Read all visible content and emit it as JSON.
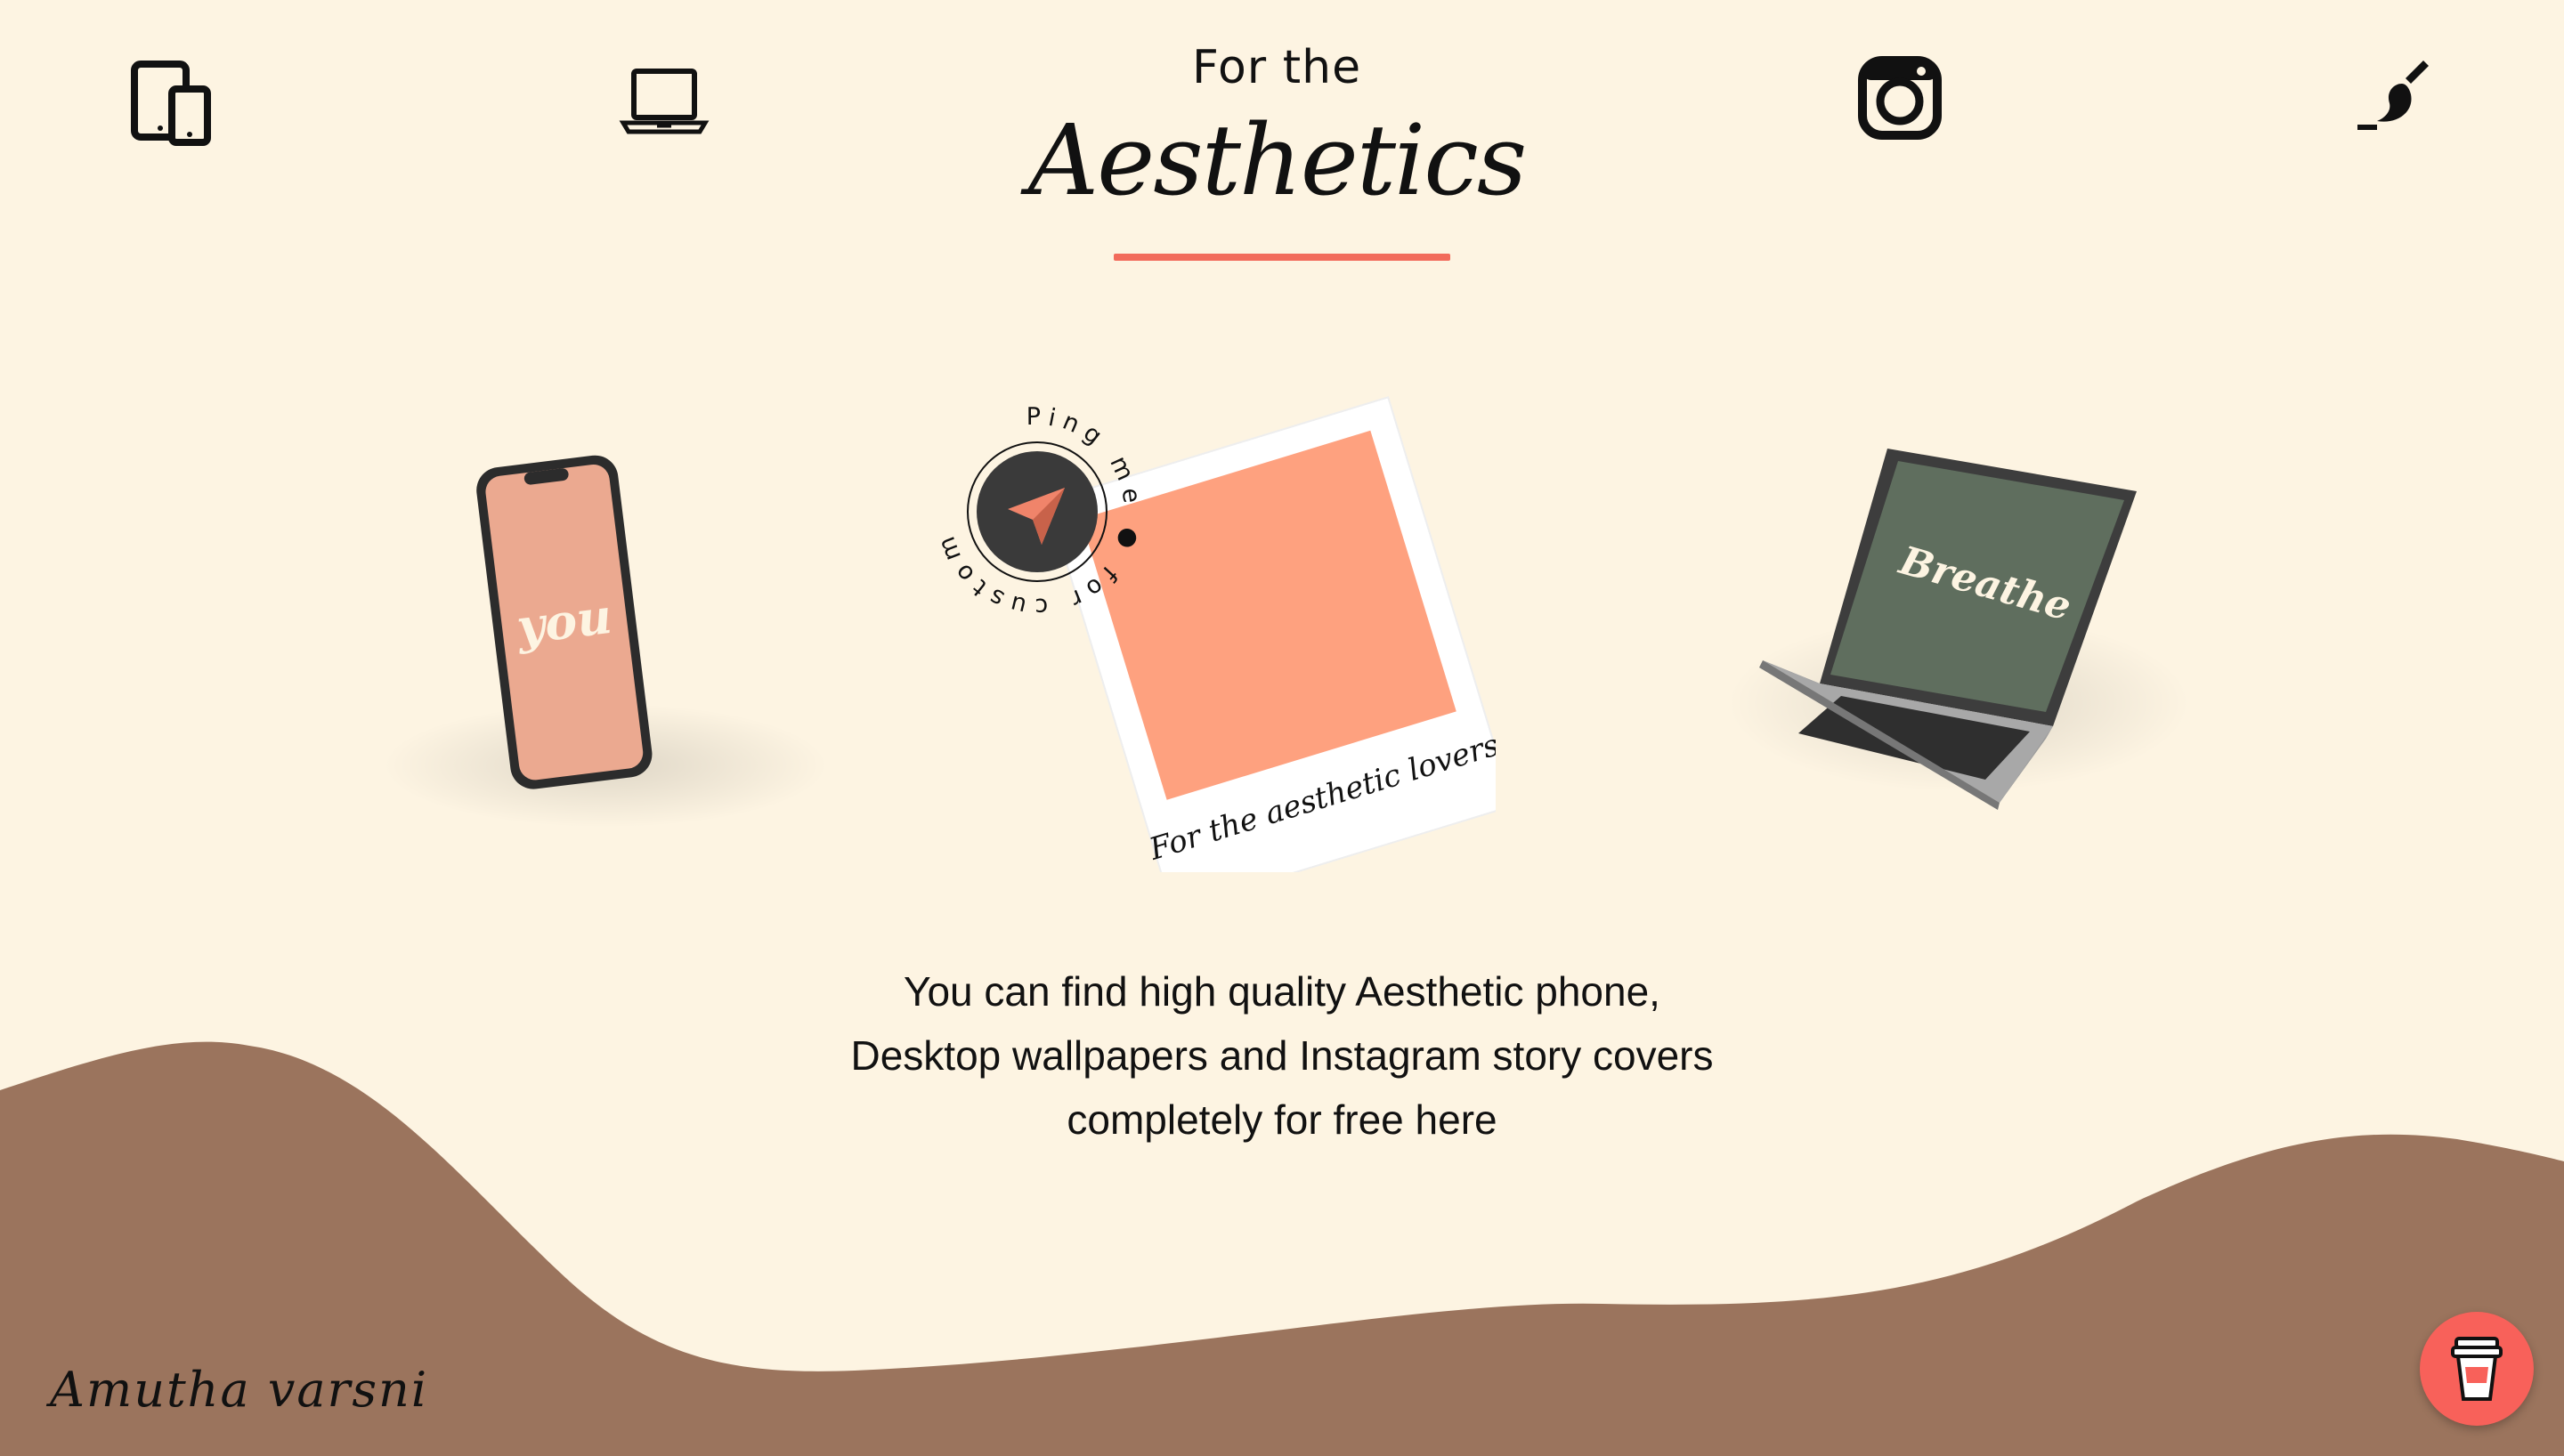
{
  "header": {
    "title_small": "For the",
    "title_script": "Aesthetics",
    "accent_color": "#f26b5b"
  },
  "nav": {
    "icons": [
      "devices-icon",
      "laptop-icon",
      "instagram-icon",
      "brush-icon"
    ]
  },
  "showcase": {
    "phone_screen_text": "you",
    "polaroid_caption": "For the aesthetic lovers",
    "badge_text": "Ping me ● for custom orders ●",
    "laptop_screen_text": "Breathe"
  },
  "main": {
    "description_lines": [
      "You can find high quality Aesthetic phone,",
      "Desktop wallpapers and Instagram story covers",
      "completely for free here"
    ]
  },
  "footer": {
    "signature": "Amutha varsni",
    "coffee_button_icon": "coffee-cup-icon",
    "wave_color": "#9b745d",
    "button_color": "#f8615a"
  }
}
